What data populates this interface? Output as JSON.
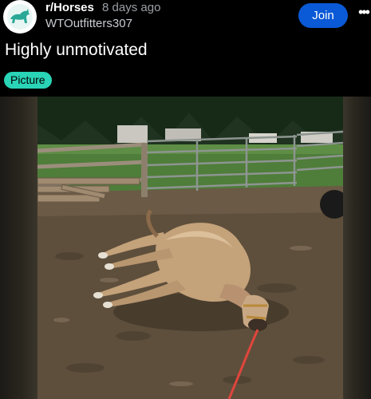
{
  "post": {
    "subreddit": "r/Horses",
    "age": "8 days ago",
    "author": "WTOutfitters307",
    "join_label": "Join",
    "more_label": "•••",
    "title": "Highly unmotivated",
    "flair": "Picture"
  },
  "colors": {
    "join_button": "#0a59d6",
    "flair_bg": "#2ad4b6",
    "background": "#000000"
  },
  "icons": {
    "avatar": "horse-avatar-icon",
    "more": "more-options-icon"
  }
}
